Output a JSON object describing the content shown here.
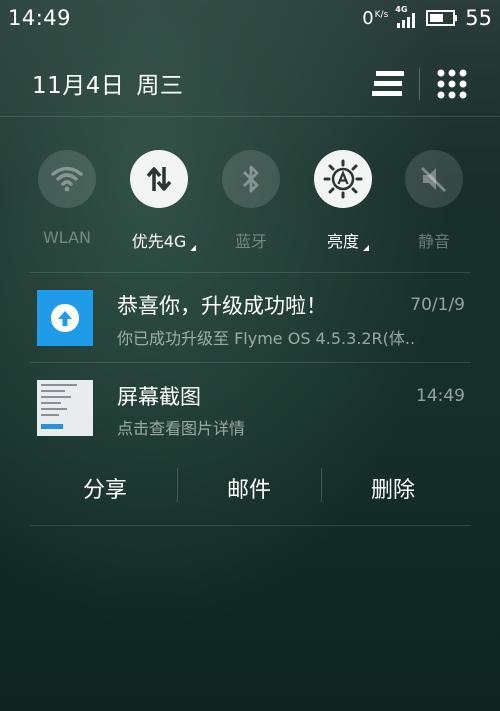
{
  "status_bar": {
    "time": "14:49",
    "net_speed": "0",
    "net_speed_unit": "K/s",
    "network_tag": "4G",
    "battery": "55"
  },
  "header": {
    "date": "11月4日",
    "weekday": "周三",
    "icons": [
      "menu-lines-icon",
      "grid-dots-icon"
    ]
  },
  "toggles": [
    {
      "label": "WLAN",
      "state": "off",
      "icon": "wifi-icon"
    },
    {
      "label": "优先4G",
      "state": "on",
      "icon": "data-arrows-icon"
    },
    {
      "label": "蓝牙",
      "state": "off",
      "icon": "bluetooth-icon"
    },
    {
      "label": "亮度",
      "state": "on",
      "icon": "brightness-auto-icon"
    },
    {
      "label": "静音",
      "state": "off",
      "icon": "mute-icon"
    }
  ],
  "notifications": [
    {
      "icon": "upgrade-arrow-icon",
      "title": "恭喜你，升级成功啦！",
      "time": "70/1/9",
      "body": "你已成功升级至 Flyme OS 4.5.3.2R(体.."
    },
    {
      "icon": "screenshot-thumbnail",
      "title": "屏幕截图",
      "time": "14:49",
      "body": "点击查看图片详情"
    }
  ],
  "actions": {
    "share": "分享",
    "mail": "邮件",
    "delete": "删除"
  },
  "colors": {
    "accent_blue": "#1f9be9",
    "toggle_on": "#f3f5f4",
    "background": "#163029"
  }
}
